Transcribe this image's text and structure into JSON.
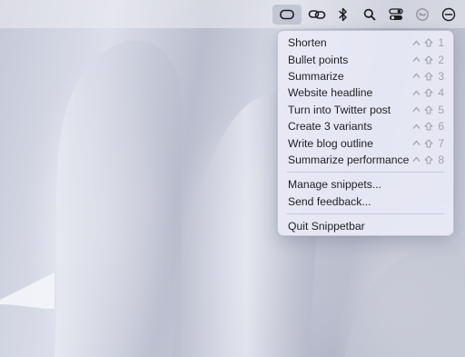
{
  "menubar": {
    "icons": [
      {
        "name": "snippetbar-icon",
        "active": true
      },
      {
        "name": "link-icon"
      },
      {
        "name": "bluetooth-icon"
      },
      {
        "name": "search-icon"
      },
      {
        "name": "control-center-icon"
      },
      {
        "name": "siri-icon"
      },
      {
        "name": "focus-icon"
      }
    ]
  },
  "menu": {
    "items": [
      {
        "label": "Shorten",
        "shortcut": "1"
      },
      {
        "label": "Bullet points",
        "shortcut": "2"
      },
      {
        "label": "Summarize",
        "shortcut": "3"
      },
      {
        "label": "Website headline",
        "shortcut": "4"
      },
      {
        "label": "Turn into Twitter post",
        "shortcut": "5"
      },
      {
        "label": "Create 3 variants",
        "shortcut": "6"
      },
      {
        "label": "Write blog outline",
        "shortcut": "7"
      },
      {
        "label": "Summarize performance",
        "shortcut": "8"
      }
    ],
    "manage_snippets": "Manage snippets...",
    "send_feedback": "Send feedback...",
    "quit": "Quit Snippetbar"
  },
  "colors": {
    "menu_bg": "#e9eaf6",
    "text": "#1f1f24",
    "shortcut": "#9fa1ad"
  }
}
